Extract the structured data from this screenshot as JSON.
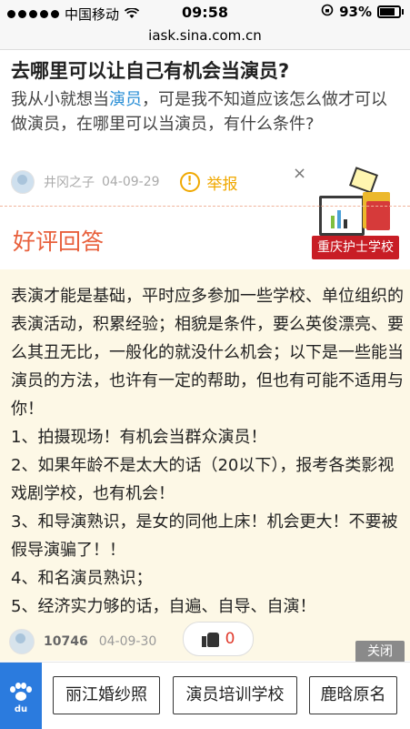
{
  "status_bar": {
    "carrier": "中国移动",
    "time": "09:58",
    "battery": "93%"
  },
  "url": "iask.sina.com.cn",
  "question": {
    "title": "去哪里可以让自己有机会当演员?",
    "body_part1": "我从小就想当",
    "body_link": "演员",
    "body_part2": "，可是我不知道应该怎么做才可以做演员，在哪里可以当演员，有什么条件?",
    "author": "井冈之子",
    "date": "04-09-29",
    "report_label": "举报"
  },
  "ad": {
    "close_symbol": "×",
    "banner_text": "重庆护士学校",
    "close_label": "关闭"
  },
  "section_title": "好评回答",
  "answer": {
    "paragraphs": [
      "表演才能是基础，平时应多参加一些学校、单位组织的表演活动，积累经验；相貌是条件，要么英俊漂亮、要么其丑无比，一般化的就没什么机会；以下是一些能当演员的方法，也许有一定的帮助，但也有可能不适用与你！",
      "1、拍摄现场！有机会当群众演员！",
      "2、如果年龄不是太大的话（20以下），报考各类影视戏剧学校，也有机会！",
      "3、和导演熟识，是女的同他上床！机会更大！不要被假导演骗了！！",
      "4、和名演员熟识；",
      "5、经济实力够的话，自遍、自导、自演！"
    ],
    "author": "10746",
    "date": "04-09-30",
    "likes": "0"
  },
  "bottom_bar": {
    "logo_text": "du",
    "tags": [
      "丽江婚纱照",
      "演员培训学校",
      "鹿晗原名"
    ]
  },
  "colors": {
    "accent_orange": "#e8603c",
    "link_blue": "#2a8fd6",
    "answer_bg": "#fdf8e6",
    "baidu_blue": "#2b7bde"
  }
}
